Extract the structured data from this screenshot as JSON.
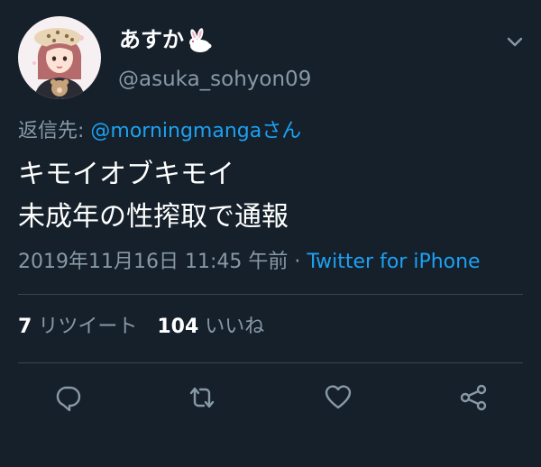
{
  "user": {
    "display_name": "あすか",
    "name_emoji": "rabbit-icon",
    "handle": "@asuka_sohyon09"
  },
  "reply": {
    "prefix": "返信先: ",
    "mention": "@morningmanga",
    "suffix": "さん"
  },
  "tweet": {
    "line1": "キモイオブキモイ",
    "line2": "未成年の性搾取で通報"
  },
  "meta": {
    "timestamp": "2019年11月16日 11:45 午前",
    "separator": " · ",
    "source": "Twitter for iPhone"
  },
  "stats": {
    "retweets_count": "7",
    "retweets_label": "リツイート",
    "likes_count": "104",
    "likes_label": "いいね"
  },
  "actions": [
    {
      "name": "reply-icon"
    },
    {
      "name": "retweet-icon"
    },
    {
      "name": "like-icon"
    },
    {
      "name": "share-icon"
    }
  ],
  "colors": {
    "background": "#15202b",
    "text_primary": "#ffffff",
    "text_secondary": "#8899a6",
    "link": "#1da1f2",
    "divider": "#38444d"
  }
}
